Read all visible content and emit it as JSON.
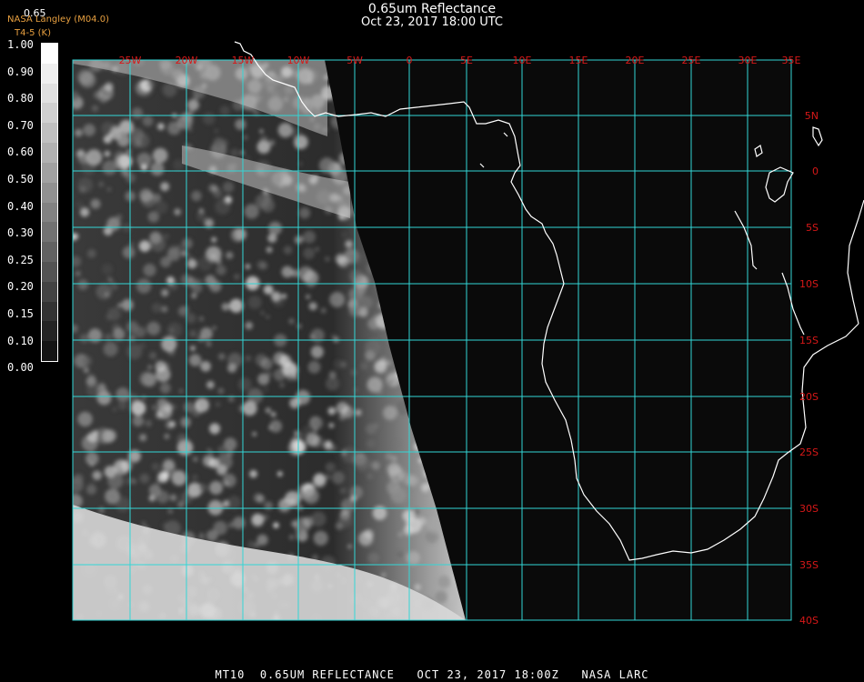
{
  "title": {
    "line1": "0.65um Reflectance",
    "line2": "Oct 23, 2017 18:00 UTC"
  },
  "credit": {
    "line1": "NASA Langley (M04.0)",
    "line2": "T4-5 (K)"
  },
  "colorbar": {
    "top_label": "0.65",
    "ticks": [
      "1.00",
      "0.90",
      "0.80",
      "0.70",
      "0.60",
      "0.50",
      "0.40",
      "0.30",
      "0.25",
      "0.20",
      "0.15",
      "0.10",
      "0.00"
    ]
  },
  "map": {
    "lon_labels": [
      "25W",
      "20W",
      "15W",
      "10W",
      "5W",
      "0",
      "5E",
      "10E",
      "15E",
      "20E",
      "25E",
      "30E",
      "35E"
    ],
    "lat_labels": [
      "5N",
      "0",
      "5S",
      "10S",
      "15S",
      "20S",
      "25S",
      "30S",
      "35S",
      "40S"
    ],
    "grid_color": "#33d6d6",
    "label_color": "#d81818",
    "coast_color": "#ffffff"
  },
  "footer": {
    "text": "MT10  0.65UM REFLECTANCE   OCT 23, 2017 18:00Z   NASA LARC"
  }
}
